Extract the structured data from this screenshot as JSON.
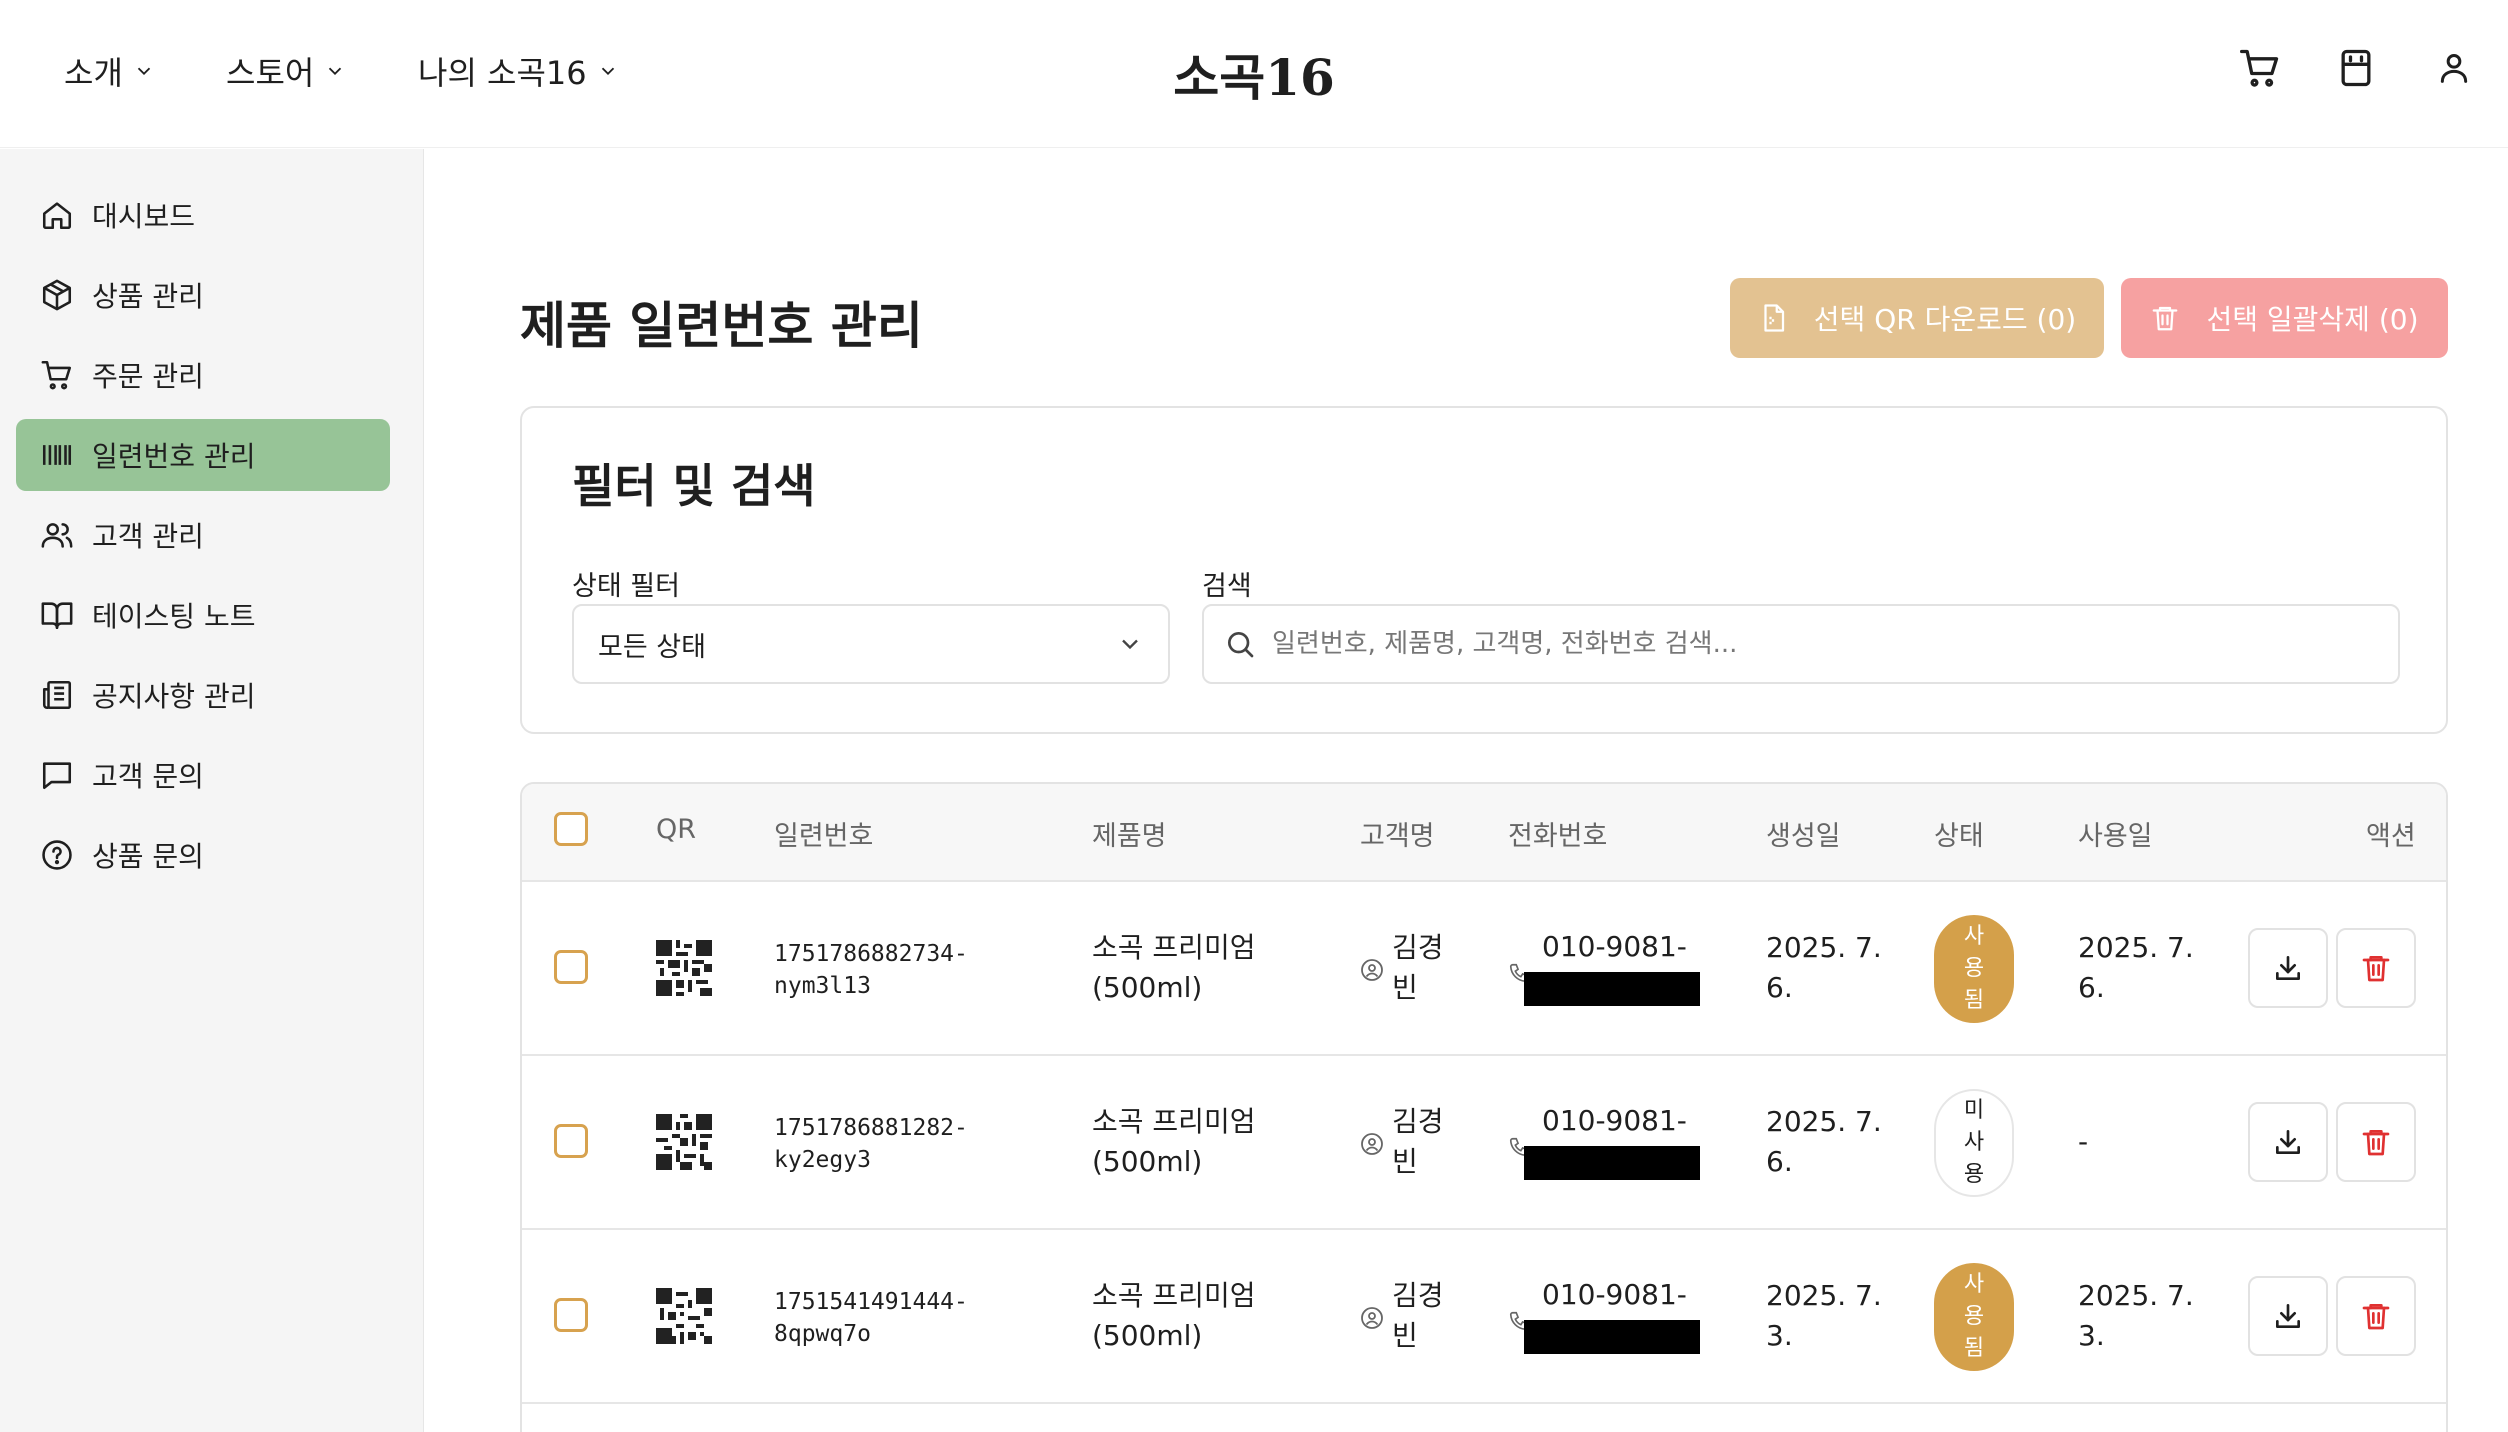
{
  "header": {
    "nav": [
      {
        "label": "소개"
      },
      {
        "label": "스토어"
      },
      {
        "label": "나의 소곡16"
      }
    ],
    "brand": "소곡16",
    "icons": [
      "cart-icon",
      "bag-icon",
      "user-icon"
    ]
  },
  "sidebar": {
    "items": [
      {
        "label": "대시보드",
        "icon": "home-icon"
      },
      {
        "label": "상품 관리",
        "icon": "box-icon"
      },
      {
        "label": "주문 관리",
        "icon": "cart-icon"
      },
      {
        "label": "일련번호 관리",
        "icon": "barcode-icon",
        "active": true
      },
      {
        "label": "고객 관리",
        "icon": "users-icon"
      },
      {
        "label": "테이스팅 노트",
        "icon": "book-icon"
      },
      {
        "label": "공지사항 관리",
        "icon": "newspaper-icon"
      },
      {
        "label": "고객 문의",
        "icon": "message-icon"
      },
      {
        "label": "상품 문의",
        "icon": "help-circle-icon"
      }
    ]
  },
  "main": {
    "title": "제품 일련번호 관리",
    "qr_download_label": "선택 QR 다운로드 (0)",
    "bulk_delete_label": "선택 일괄삭제 (0)",
    "colors": {
      "qr_button": "#e3c291",
      "delete_button": "#f6a1a1",
      "active_sidebar": "#97c497",
      "used_badge": "#d4a04a"
    }
  },
  "filter": {
    "title": "필터 및 검색",
    "status_label": "상태 필터",
    "status_value": "모든 상태",
    "search_label": "검색",
    "search_placeholder": "일련번호, 제품명, 고객명, 전화번호 검색..."
  },
  "table": {
    "headers": {
      "qr": "QR",
      "serial": "일련번호",
      "product": "제품명",
      "customer": "고객명",
      "phone": "전화번호",
      "created": "생성일",
      "status": "상태",
      "used": "사용일",
      "actions": "액션"
    },
    "rows": [
      {
        "serial1": "1751786882734-",
        "serial2": "nym3l13",
        "product1": "소곡 프리미엄",
        "product2": "(500ml)",
        "cust1": "김경",
        "cust2": "빈",
        "phone": "010-9081-",
        "created1": "2025. 7.",
        "created2": "6.",
        "status": [
          "사",
          "용",
          "됨"
        ],
        "status_type": "used",
        "used1": "2025. 7.",
        "used2": "6."
      },
      {
        "serial1": "1751786881282-",
        "serial2": "ky2egy3",
        "product1": "소곡 프리미엄",
        "product2": "(500ml)",
        "cust1": "김경",
        "cust2": "빈",
        "phone": "010-9081-",
        "created1": "2025. 7.",
        "created2": "6.",
        "status": [
          "미",
          "사",
          "용"
        ],
        "status_type": "unused",
        "used1": "-",
        "used2": ""
      },
      {
        "serial1": "1751541491444-",
        "serial2": "8qpwq7o",
        "product1": "소곡 프리미엄",
        "product2": "(500ml)",
        "cust1": "김경",
        "cust2": "빈",
        "phone": "010-9081-",
        "created1": "2025. 7.",
        "created2": "3.",
        "status": [
          "사",
          "용",
          "됨"
        ],
        "status_type": "used",
        "used1": "2025. 7.",
        "used2": "3."
      }
    ]
  }
}
